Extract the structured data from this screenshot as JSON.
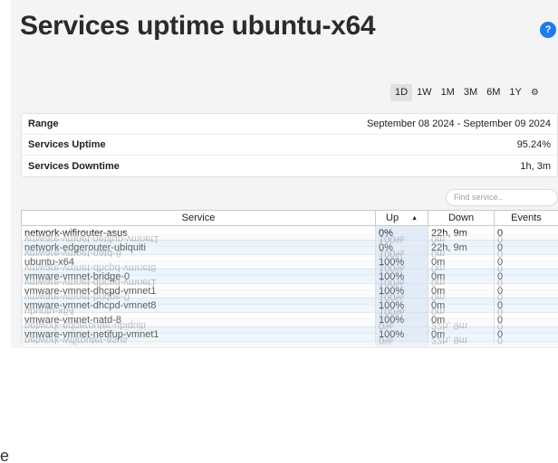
{
  "header": {
    "title": "Services uptime ubuntu-x64",
    "help_glyph": "?"
  },
  "range_buttons": [
    "1D",
    "1W",
    "1M",
    "3M",
    "6M",
    "1Y"
  ],
  "active_range": "1D",
  "summary": {
    "range_label": "Range",
    "range_value": "September 08 2024 - September 09 2024",
    "uptime_label": "Services Uptime",
    "uptime_value": "95.24%",
    "downtime_label": "Services Downtime",
    "downtime_value": "1h, 3m"
  },
  "search": {
    "placeholder": "Find service.."
  },
  "table": {
    "headers": {
      "service": "Service",
      "up": "Up",
      "down": "Down",
      "events": "Events"
    },
    "rows": [
      {
        "service": "network-wifirouter-asus",
        "up": "0%",
        "down": "22h, 9m",
        "events": "0"
      },
      {
        "service": "network-edgerouter-ubiquiti",
        "up": "0%",
        "down": "22h, 9m",
        "events": "0"
      },
      {
        "service": "ubuntu-x64",
        "up": "100%",
        "down": "0m",
        "events": "0"
      },
      {
        "service": "vmware-vmnet-bridge-0",
        "up": "100%",
        "down": "0m",
        "events": "0"
      },
      {
        "service": "vmware-vmnet-dhcpd-vmnet1",
        "up": "100%",
        "down": "0m",
        "events": "0"
      },
      {
        "service": "vmware-vmnet-dhcpd-vmnet8",
        "up": "100%",
        "down": "0m",
        "events": "0"
      },
      {
        "service": "vmware-vmnet-natd-8",
        "up": "100%",
        "down": "0m",
        "events": "0"
      },
      {
        "service": "vmware-vmnet-netifup-vmnet1",
        "up": "100%",
        "down": "0m",
        "events": "0"
      }
    ]
  },
  "edge_glyph": "e"
}
